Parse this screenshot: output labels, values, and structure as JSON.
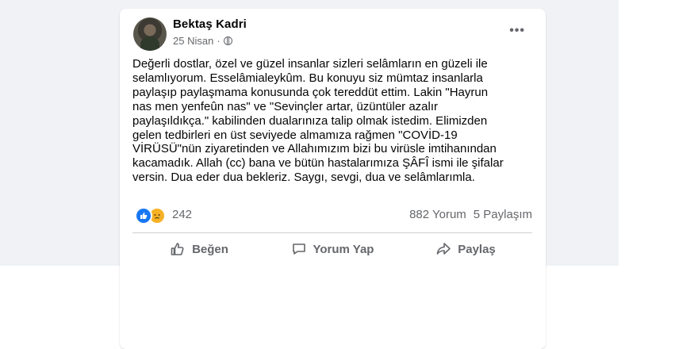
{
  "post": {
    "author": "Bektaş Kadri",
    "date": "25 Nisan",
    "date_separator": "·",
    "more_icon": "•••",
    "text": "Değerli dostlar, özel ve  güzel insanlar sizleri selâmların en güzeli ile\nselamlıyorum. Esselâmialeykûm. Bu konuyu siz mümtaz insanlarla\npaylaşıp paylaşmama konusunda çok tereddüt ettim. Lakin \"Hayrun\nnas men yenfeûn nas\" ve \"Sevinçler artar, üzüntüler azalır\npaylaşıldıkça.\" kabilinden dualarınıza talip olmak  istedim. Elimizden\ngelen tedbirleri en üst seviyede almamıza rağmen \"COVİD-19\nVİRÜSÜ\"nün ziyaretinden ve Allahımızım bizi  bu virüsle imtihanından\nkacamadık. Allah (cc) bana ve bütün hastalarımıza ŞÂFÎ ismi ile şifalar\nversin. Dua eder dua bekleriz. Saygı, sevgi, dua ve selâmlarımla."
  },
  "reactions": {
    "count": "242",
    "icons": [
      "like-icon",
      "sad-icon"
    ],
    "comments": "882 Yorum",
    "shares": "5 Paylaşım"
  },
  "actions": {
    "like": "Beğen",
    "comment": "Yorum Yap",
    "share": "Paylaş"
  },
  "colors": {
    "background": "#f0f2f5",
    "like_blue": "#1877f2",
    "sad_yellow": "#f7b125",
    "secondary_text": "#65676b"
  }
}
